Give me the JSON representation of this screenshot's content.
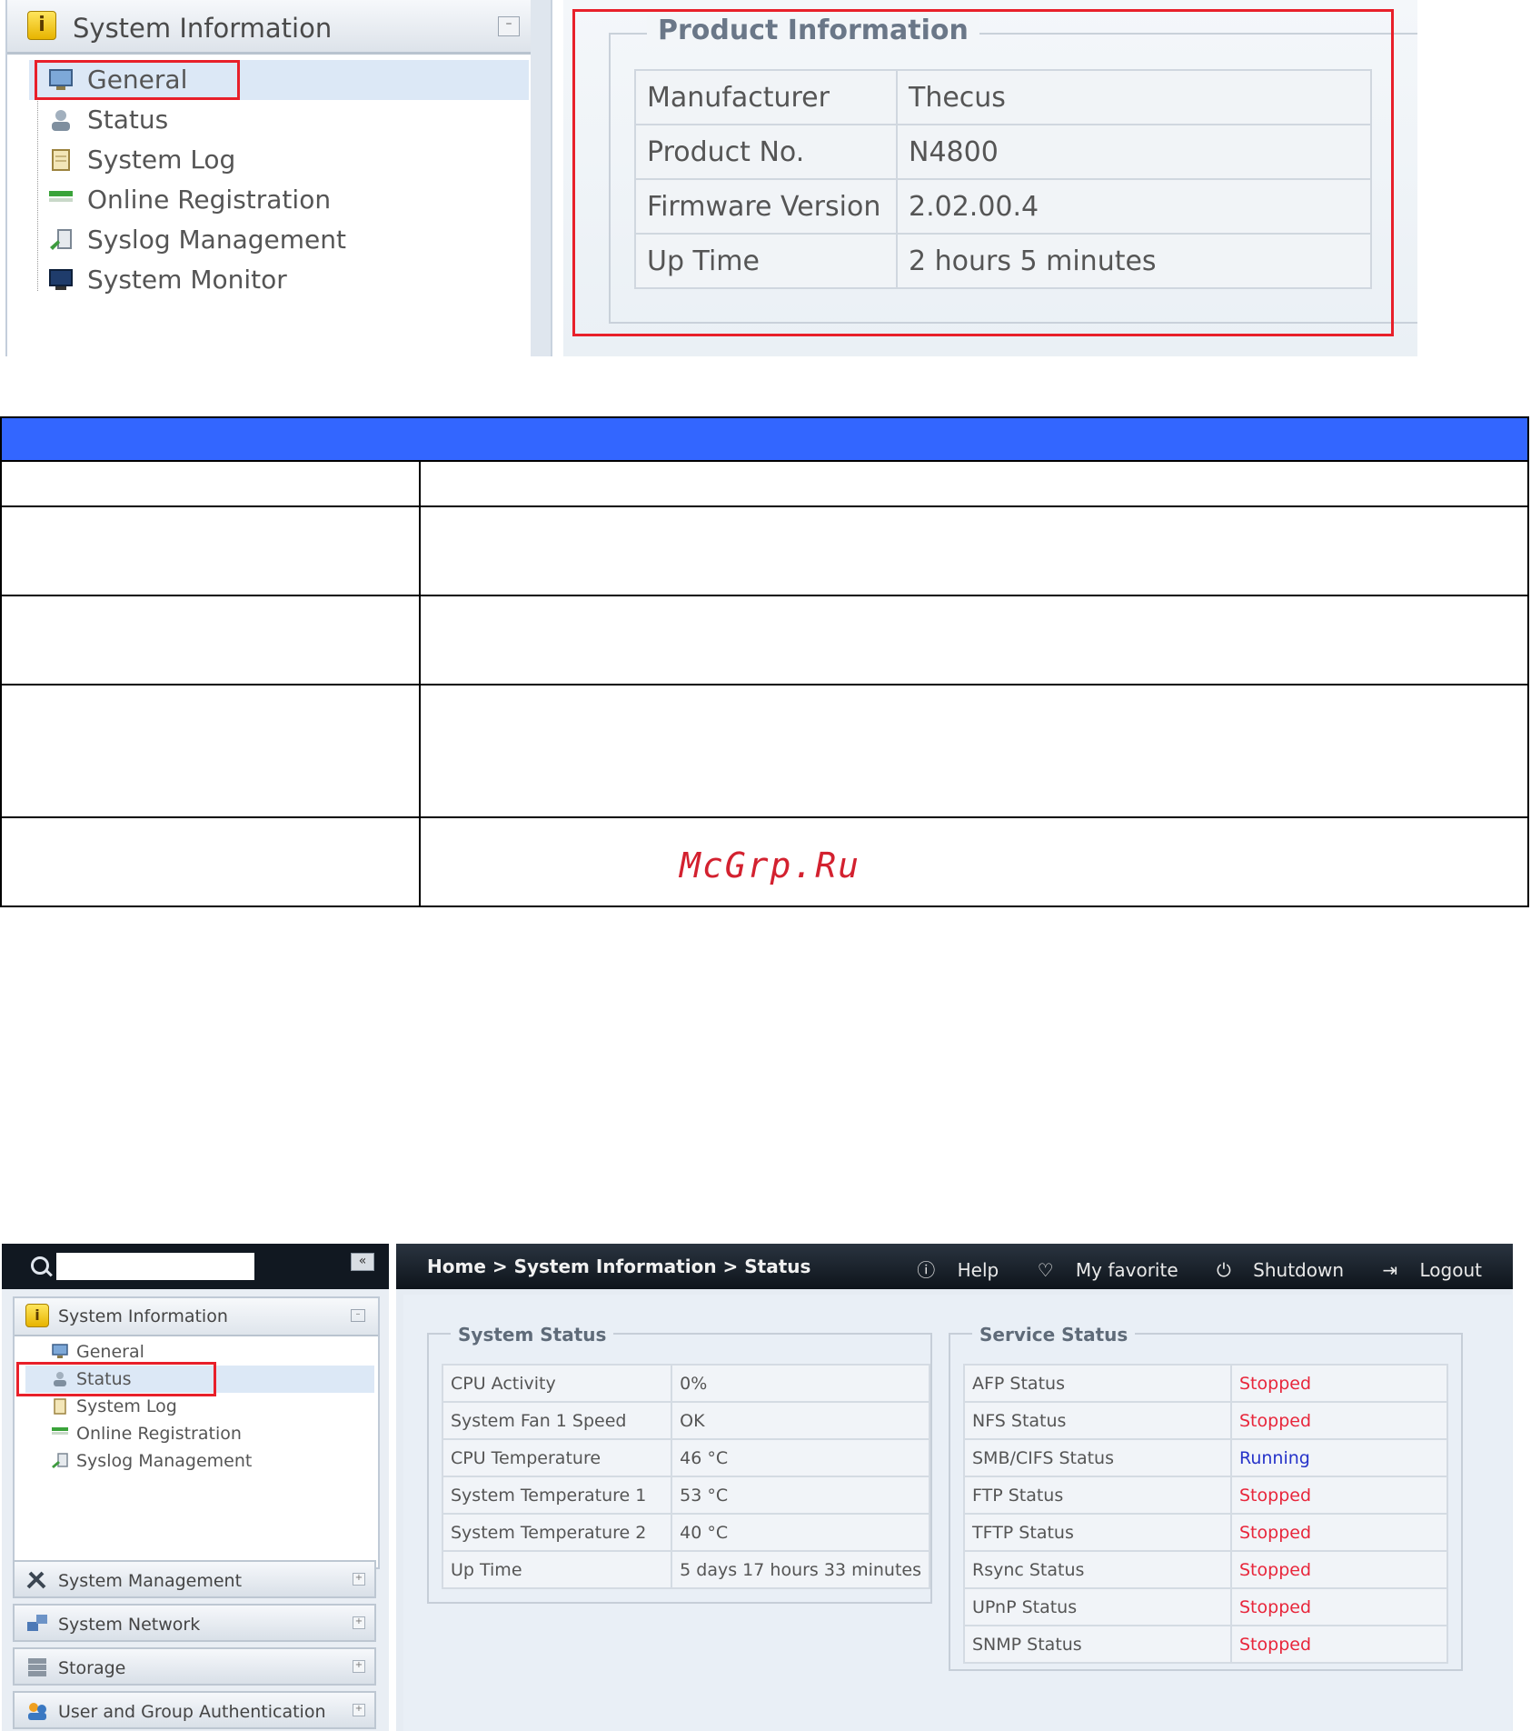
{
  "top_screenshot": {
    "panel_title": "System Information",
    "collapse_glyph": "–",
    "tree_items": [
      {
        "label": "General",
        "icon": "monitor-icon"
      },
      {
        "label": "Status",
        "icon": "user-icon"
      },
      {
        "label": "System Log",
        "icon": "log-icon"
      },
      {
        "label": "Online Registration",
        "icon": "registration-icon"
      },
      {
        "label": "Syslog Management",
        "icon": "syslog-icon"
      },
      {
        "label": "System Monitor",
        "icon": "monitor-icon"
      }
    ],
    "product_info": {
      "legend": "Product Information",
      "rows": [
        {
          "key": "Manufacturer",
          "value": "Thecus"
        },
        {
          "key": "Product No.",
          "value": "N4800"
        },
        {
          "key": "Firmware Version",
          "value": "2.02.00.4"
        },
        {
          "key": "Up Time",
          "value": "2 hours 5 minutes"
        }
      ]
    }
  },
  "watermark": "McGrp.Ru",
  "bottom_screenshot": {
    "search_placeholder": "",
    "collapse_glyph": "«",
    "panel_title": "System Information",
    "panel_glyph": "–",
    "tree_items": [
      {
        "label": "General",
        "icon": "monitor-icon"
      },
      {
        "label": "Status",
        "icon": "user-icon"
      },
      {
        "label": "System Log",
        "icon": "log-icon"
      },
      {
        "label": "Online Registration",
        "icon": "registration-icon"
      },
      {
        "label": "Syslog Management",
        "icon": "syslog-icon"
      }
    ],
    "nav_groups": [
      {
        "label": "System Management",
        "icon": "tools-icon"
      },
      {
        "label": "System Network",
        "icon": "network-icon"
      },
      {
        "label": "Storage",
        "icon": "storage-icon"
      },
      {
        "label": "User and Group Authentication",
        "icon": "users-icon"
      }
    ],
    "plus_glyph": "+",
    "breadcrumb": "Home > System Information > Status",
    "actions": {
      "help": "Help",
      "favorite": "My favorite",
      "shutdown": "Shutdown",
      "logout": "Logout"
    },
    "system_status": {
      "legend": "System Status",
      "rows": [
        {
          "key": "CPU Activity",
          "value": "0%"
        },
        {
          "key": "System Fan 1 Speed",
          "value": "OK"
        },
        {
          "key": "CPU Temperature",
          "value": "46 °C"
        },
        {
          "key": "System Temperature 1",
          "value": "53 °C"
        },
        {
          "key": "System Temperature 2",
          "value": "40 °C"
        },
        {
          "key": "Up Time",
          "value": "5 days 17 hours 33 minutes"
        }
      ]
    },
    "service_status": {
      "legend": "Service Status",
      "rows": [
        {
          "key": "AFP Status",
          "value": "Stopped"
        },
        {
          "key": "NFS Status",
          "value": "Stopped"
        },
        {
          "key": "SMB/CIFS Status",
          "value": "Running"
        },
        {
          "key": "FTP Status",
          "value": "Stopped"
        },
        {
          "key": "TFTP Status",
          "value": "Stopped"
        },
        {
          "key": "Rsync Status",
          "value": "Stopped"
        },
        {
          "key": "UPnP Status",
          "value": "Stopped"
        },
        {
          "key": "SNMP Status",
          "value": "Stopped"
        }
      ]
    },
    "colors": {
      "stopped": "#e8263b",
      "running": "#2633c9",
      "highlight": "#e8202a",
      "table_header": "#3366ff"
    }
  }
}
